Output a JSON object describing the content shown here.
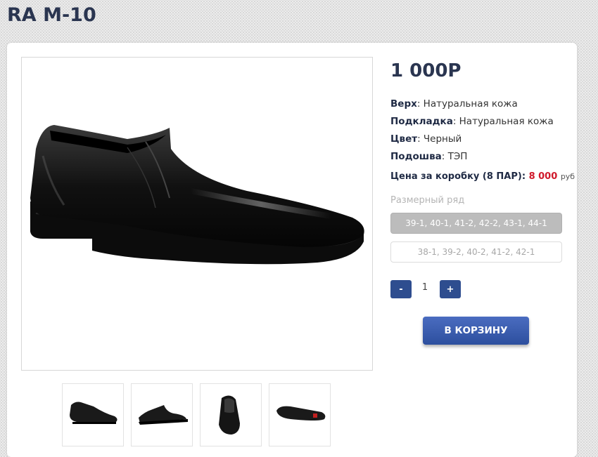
{
  "product": {
    "title": "RA M-10",
    "price": "1 000Р"
  },
  "specs": [
    {
      "label": "Верх",
      "value": ": Натуральная кожа"
    },
    {
      "label": "Подкладка",
      "value": ": Натуральная кожа"
    },
    {
      "label": "Цвет",
      "value": ": Черный"
    },
    {
      "label": "Подошва",
      "value": ": ТЭП"
    }
  ],
  "box_price": {
    "label": "Цена за коробку (8 ПАР):",
    "amount": "8 000",
    "currency": "руб"
  },
  "sizes": {
    "label": "Размерный ряд",
    "options": [
      "39-1, 40-1, 41-2, 42-2, 43-1, 44-1",
      "38-1, 39-2, 40-2, 41-2, 42-1"
    ],
    "selected_index": 0
  },
  "quantity": {
    "minus_label": "-",
    "value": "1",
    "plus_label": "+"
  },
  "cart_button": "В КОРЗИНУ",
  "colors": {
    "accent": "#2e4d8f",
    "price_red": "#d0192b",
    "title": "#2a3550"
  },
  "thumbnails": [
    "shoe-side-view",
    "shoe-side-view-2",
    "shoe-front-view",
    "shoe-sole-view"
  ]
}
